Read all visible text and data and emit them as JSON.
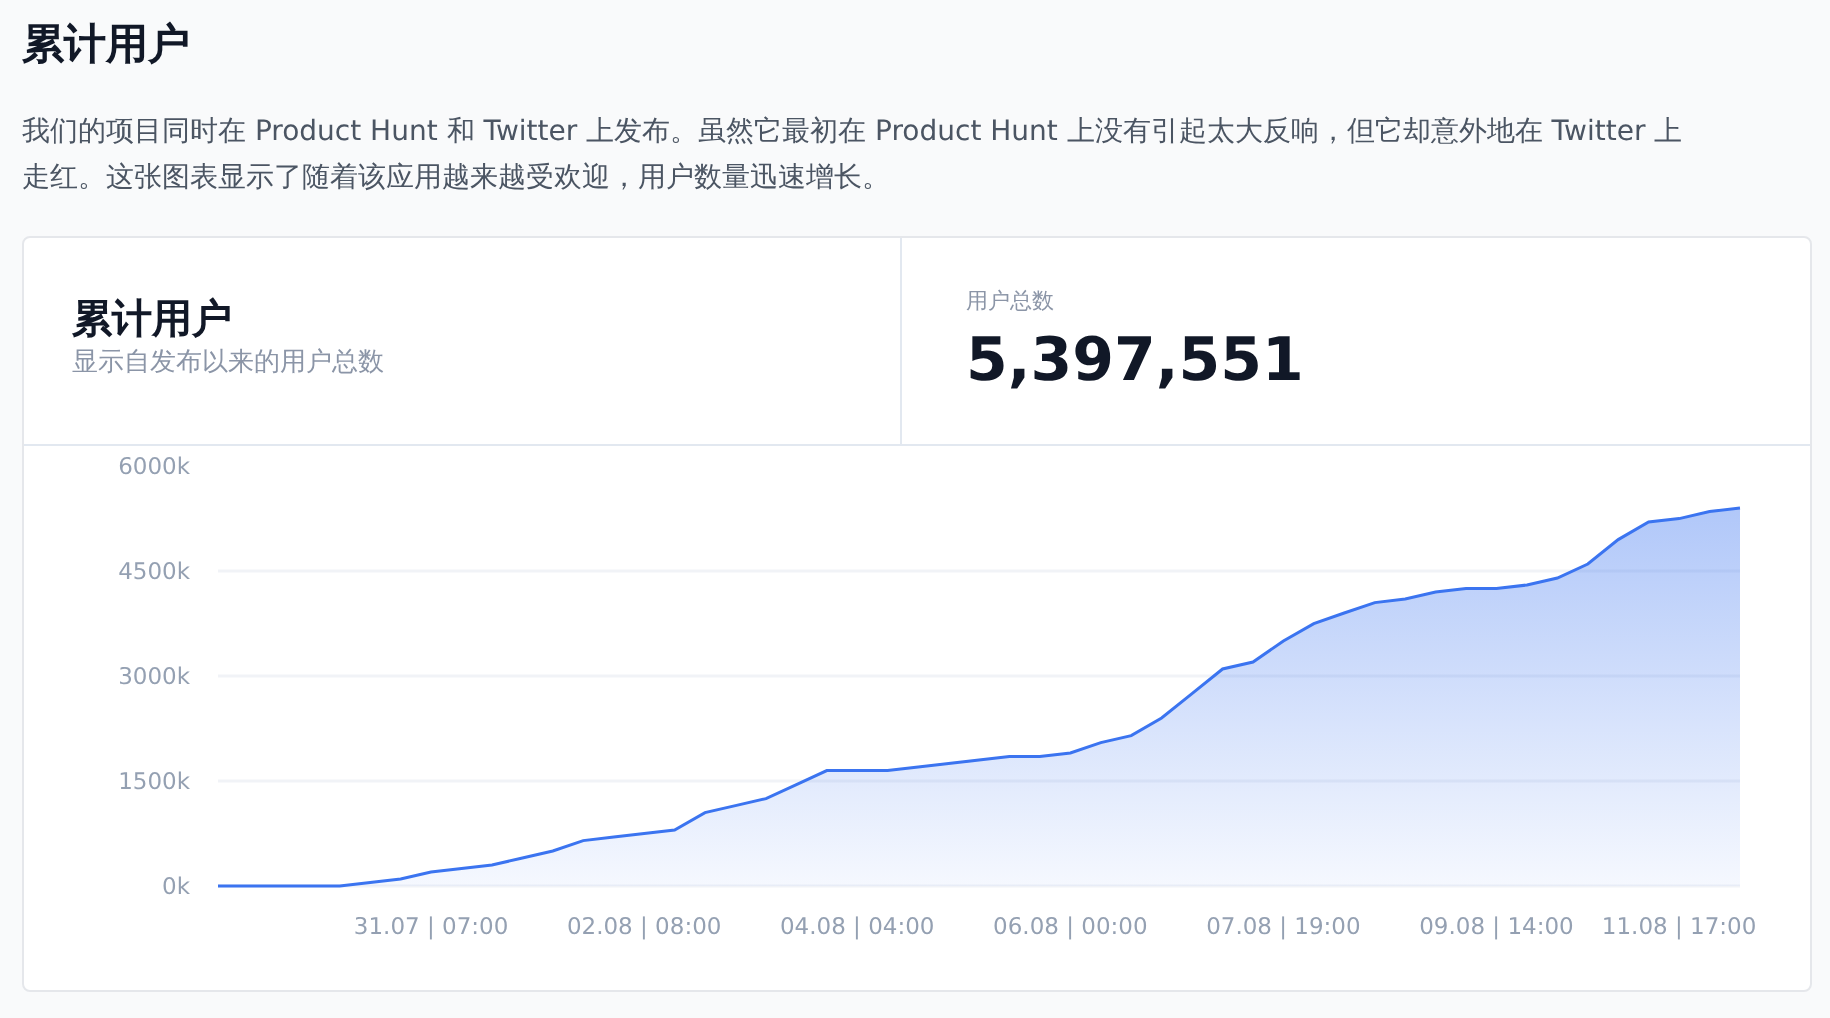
{
  "title": "累计用户",
  "description": "我们的项目同时在 Product Hunt 和 Twitter 上发布。虽然它最初在 Product Hunt 上没有引起太大反响，但它却意外地在 Twitter 上走红。这张图表显示了随着该应用越来越受欢迎，用户数量迅速增长。",
  "card": {
    "title": "累计用户",
    "subtitle": "显示自发布以来的用户总数",
    "stat": {
      "label": "用户总数",
      "value": "5,397,551"
    },
    "chart_data": {
      "type": "area",
      "categories": [
        null,
        null,
        null,
        null,
        null,
        null,
        null,
        "31.07 | 07:00",
        null,
        null,
        null,
        null,
        null,
        null,
        "02.08 | 08:00",
        null,
        null,
        null,
        null,
        null,
        null,
        "04.08 | 04:00",
        null,
        null,
        null,
        null,
        null,
        null,
        "06.08 | 00:00",
        null,
        null,
        null,
        null,
        null,
        null,
        "07.08 | 19:00",
        null,
        null,
        null,
        null,
        null,
        null,
        "09.08 | 14:00",
        null,
        null,
        null,
        null,
        null,
        "11.08 | 17:00",
        null,
        null
      ],
      "series": [
        {
          "color": "#3b74f0",
          "values": [
            0,
            0,
            0,
            0,
            0,
            50,
            100,
            200,
            250,
            300,
            400,
            500,
            650,
            700,
            750,
            800,
            1050,
            1150,
            1250,
            1450,
            1650,
            1650,
            1650,
            1700,
            1750,
            1800,
            1850,
            1850,
            1900,
            2050,
            2150,
            2400,
            2750,
            3100,
            3200,
            3500,
            3750,
            3900,
            4050,
            4100,
            4200,
            4250,
            4250,
            4300,
            4400,
            4600,
            4950,
            5200,
            5250,
            5350,
            5400
          ]
        }
      ],
      "ylim": [
        0,
        6000
      ],
      "grid": true,
      "yticks": [
        {
          "value": 0,
          "label": "0k"
        },
        {
          "value": 1500,
          "label": "1500k"
        },
        {
          "value": 3000,
          "label": "3000k"
        },
        {
          "value": 4500,
          "label": "4500k"
        },
        {
          "value": 6000,
          "label": "6000k"
        }
      ]
    }
  }
}
